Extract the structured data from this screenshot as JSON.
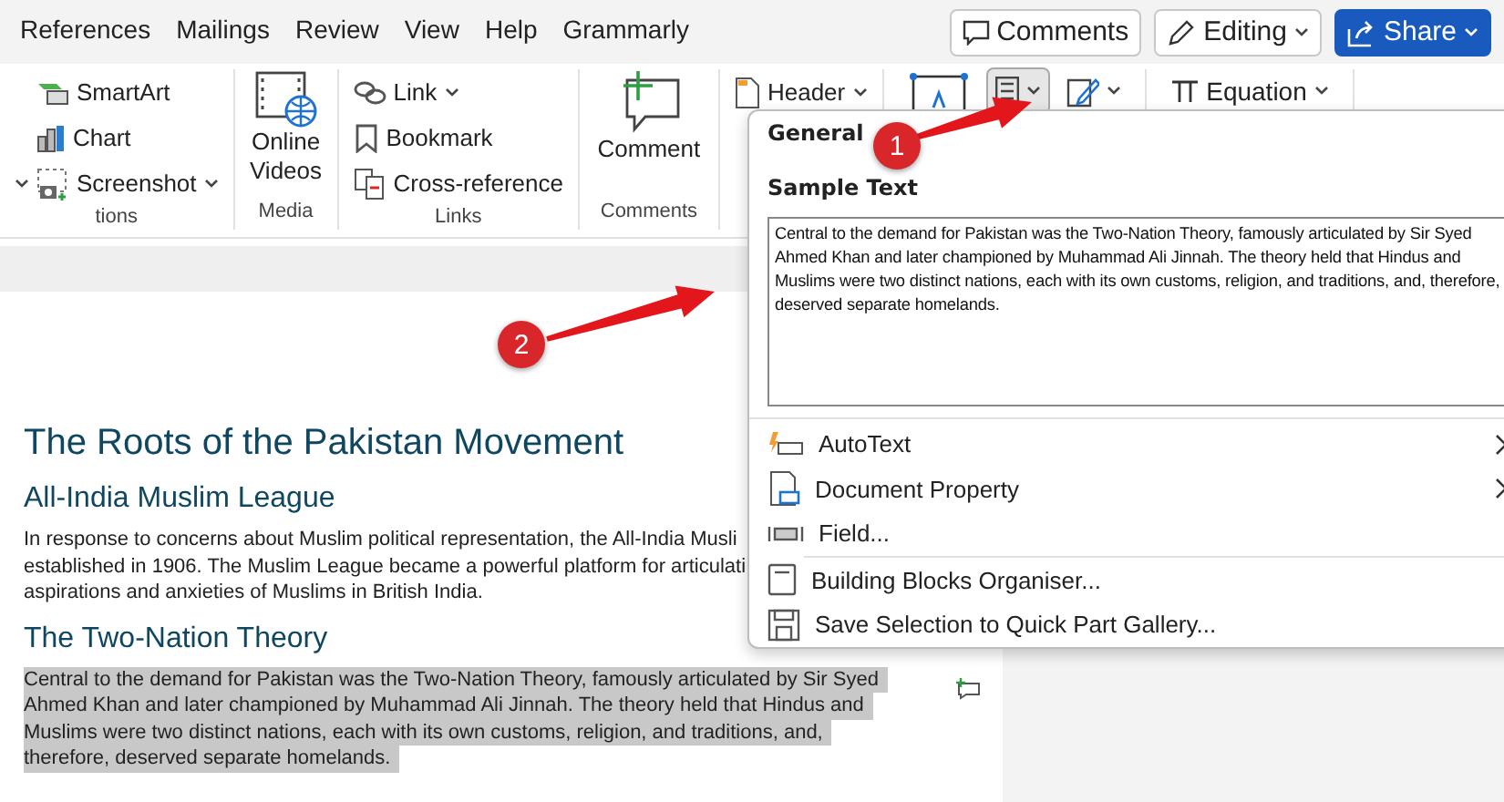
{
  "tabs": [
    {
      "label": "References",
      "selected": false
    },
    {
      "label": "Mailings",
      "selected": false
    },
    {
      "label": "Review",
      "selected": false
    },
    {
      "label": "View",
      "selected": false
    },
    {
      "label": "Help",
      "selected": false
    },
    {
      "label": "Grammarly",
      "selected": false
    }
  ],
  "header_buttons": [
    {
      "kind": "comments",
      "label": "Comments"
    },
    {
      "kind": "editing",
      "label": "Editing"
    },
    {
      "kind": "share",
      "label": "Share"
    }
  ],
  "ribbon": {
    "groups": [
      {
        "kind": "list",
        "label": "tions",
        "lead_caret": true,
        "items": [
          {
            "kind": "smartart",
            "label": "SmartArt",
            "dropdown": false
          },
          {
            "kind": "chart",
            "label": "Chart",
            "dropdown": false
          },
          {
            "kind": "screenshot",
            "label": "Screenshot",
            "dropdown": true
          }
        ]
      },
      {
        "kind": "large",
        "label": "Media",
        "items": [
          {
            "kind": "video",
            "label": "Online Videos",
            "dropdown": false
          }
        ]
      },
      {
        "kind": "list",
        "label": "Links",
        "items": [
          {
            "kind": "link",
            "label": "Link",
            "dropdown": true
          },
          {
            "kind": "bookmark",
            "label": "Bookmark",
            "dropdown": false
          },
          {
            "kind": "crossref",
            "label": "Cross-reference",
            "dropdown": false
          }
        ]
      },
      {
        "kind": "large",
        "label": "Comments",
        "items": [
          {
            "kind": "comment",
            "label": "Comment",
            "dropdown": false
          }
        ]
      },
      {
        "kind": "list",
        "items": [
          {
            "kind": "header",
            "label": "Header",
            "dropdown": true
          }
        ]
      },
      {
        "kind": "row",
        "items": [
          {
            "kind": "textbox",
            "dropdown": false,
            "selected": false
          },
          {
            "kind": "quickparts",
            "dropdown": true,
            "selected": true
          },
          {
            "kind": "signature",
            "dropdown": true,
            "selected": false
          }
        ]
      },
      {
        "kind": "row",
        "items": [
          {
            "kind": "equation",
            "label": "Equation",
            "dropdown": true,
            "selected": false
          }
        ]
      }
    ]
  },
  "document": {
    "blocks": [
      {
        "kind": "title",
        "text": "The Roots of the Pakistan Movement"
      },
      {
        "kind": "heading",
        "text": "All-India Muslim League"
      },
      {
        "kind": "paragraph",
        "selected": false,
        "lines": [
          "In response to concerns about Muslim political representation, the All-India Musli",
          "established in 1906. The Muslim League became a powerful platform for articulati",
          "aspirations and anxieties of Muslims in British India."
        ]
      },
      {
        "kind": "heading",
        "text": "The Two-Nation Theory"
      },
      {
        "kind": "paragraph",
        "selected": true,
        "comment_marker": true,
        "lines": [
          "Central to the demand for Pakistan was the Two-Nation Theory, famously articulated by Sir Syed",
          "Ahmed Khan and later championed by Muhammad Ali Jinnah. The theory held that Hindus and",
          "Muslims were two distinct nations, each with its own customs, religion, and traditions, and,",
          "therefore, deserved separate homelands."
        ]
      }
    ]
  },
  "quick_parts_menu": {
    "section": "General",
    "preview_title": "Sample Text",
    "preview_text": "Central to the demand for Pakistan was the Two-Nation Theory, famously articulated by Sir Syed Ahmed Khan and later championed by Muhammad Ali Jinnah. The theory held that Hindus and Muslims were two distinct nations, each with its own customs, religion, and traditions, and, therefore, deserved separate homelands.",
    "items": [
      {
        "kind": "autotext",
        "label": "AutoText",
        "submenu": true
      },
      {
        "kind": "docprop",
        "label": "Document Property",
        "submenu": true
      },
      {
        "kind": "field",
        "label": "Field...",
        "submenu": false,
        "divider_after": true
      },
      {
        "kind": "buildingblocks",
        "label": "Building Blocks Organiser...",
        "submenu": false
      },
      {
        "kind": "save",
        "label": "Save Selection to Quick Part Gallery...",
        "submenu": false
      }
    ]
  },
  "annotations": [
    {
      "label": "1"
    },
    {
      "label": "2"
    }
  ]
}
